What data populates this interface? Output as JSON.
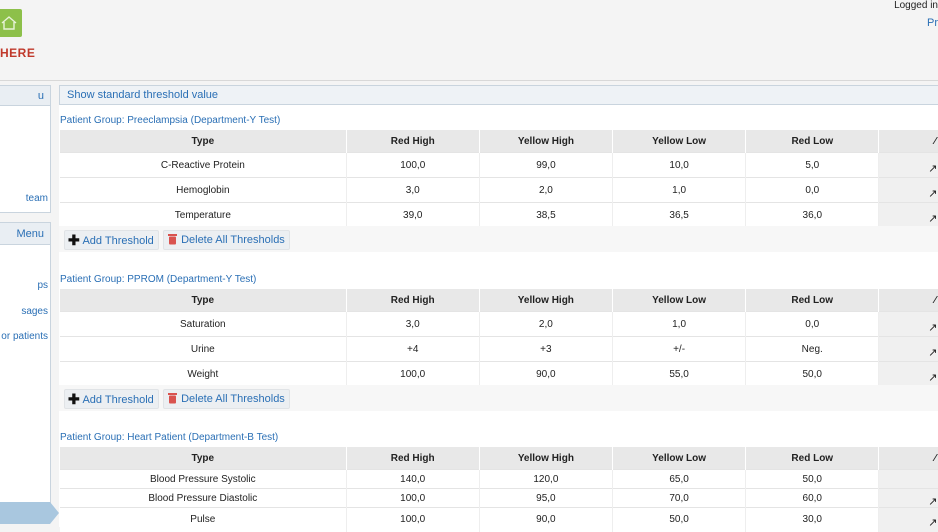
{
  "header": {
    "logo_text": "HERE",
    "logged_in": "Logged in",
    "profile_link": "Pr"
  },
  "sidebar": {
    "panel1": {
      "title": "u",
      "items": [
        "team"
      ]
    },
    "panel2": {
      "title": "Menu",
      "items": [
        "ps",
        "sages",
        "or patients"
      ]
    }
  },
  "main": {
    "bar_title": "Show standard threshold value",
    "columns": [
      "Type",
      "Red High",
      "Yellow High",
      "Yellow Low",
      "Red Low"
    ],
    "add_label": "Add Threshold",
    "delete_label": "Delete All Thresholds",
    "groups": [
      {
        "title": "Patient Group: Preeclampsia (Department-Y Test)",
        "rows": [
          [
            "C-Reactive Protein",
            "100,0",
            "99,0",
            "10,0",
            "5,0"
          ],
          [
            "Hemoglobin",
            "3,0",
            "2,0",
            "1,0",
            "0,0"
          ],
          [
            "Temperature",
            "39,0",
            "38,5",
            "36,5",
            "36,0"
          ]
        ]
      },
      {
        "title": "Patient Group: PPROM (Department-Y Test)",
        "rows": [
          [
            "Saturation",
            "3,0",
            "2,0",
            "1,0",
            "0,0"
          ],
          [
            "Urine",
            "+4",
            "+3",
            "+/-",
            "Neg."
          ],
          [
            "Weight",
            "100,0",
            "90,0",
            "55,0",
            "50,0"
          ]
        ]
      },
      {
        "title": "Patient Group: Heart Patient (Department-B Test)",
        "rows": [
          [
            "Blood Pressure Systolic",
            "140,0",
            "120,0",
            "65,0",
            "50,0"
          ],
          [
            "Blood Pressure Diastolic",
            "100,0",
            "95,0",
            "70,0",
            "60,0"
          ],
          [
            "Pulse",
            "100,0",
            "90,0",
            "50,0",
            "30,0"
          ]
        ]
      }
    ]
  },
  "icons": {
    "logo": "house-icon",
    "add": "plus-icon",
    "delete": "trash-icon",
    "edit": "pencil-icon"
  },
  "colors": {
    "link": "#2a6fb5",
    "logo_green": "#8dc04a",
    "logo_red": "#c0392b",
    "delete_red": "#d9534f"
  }
}
